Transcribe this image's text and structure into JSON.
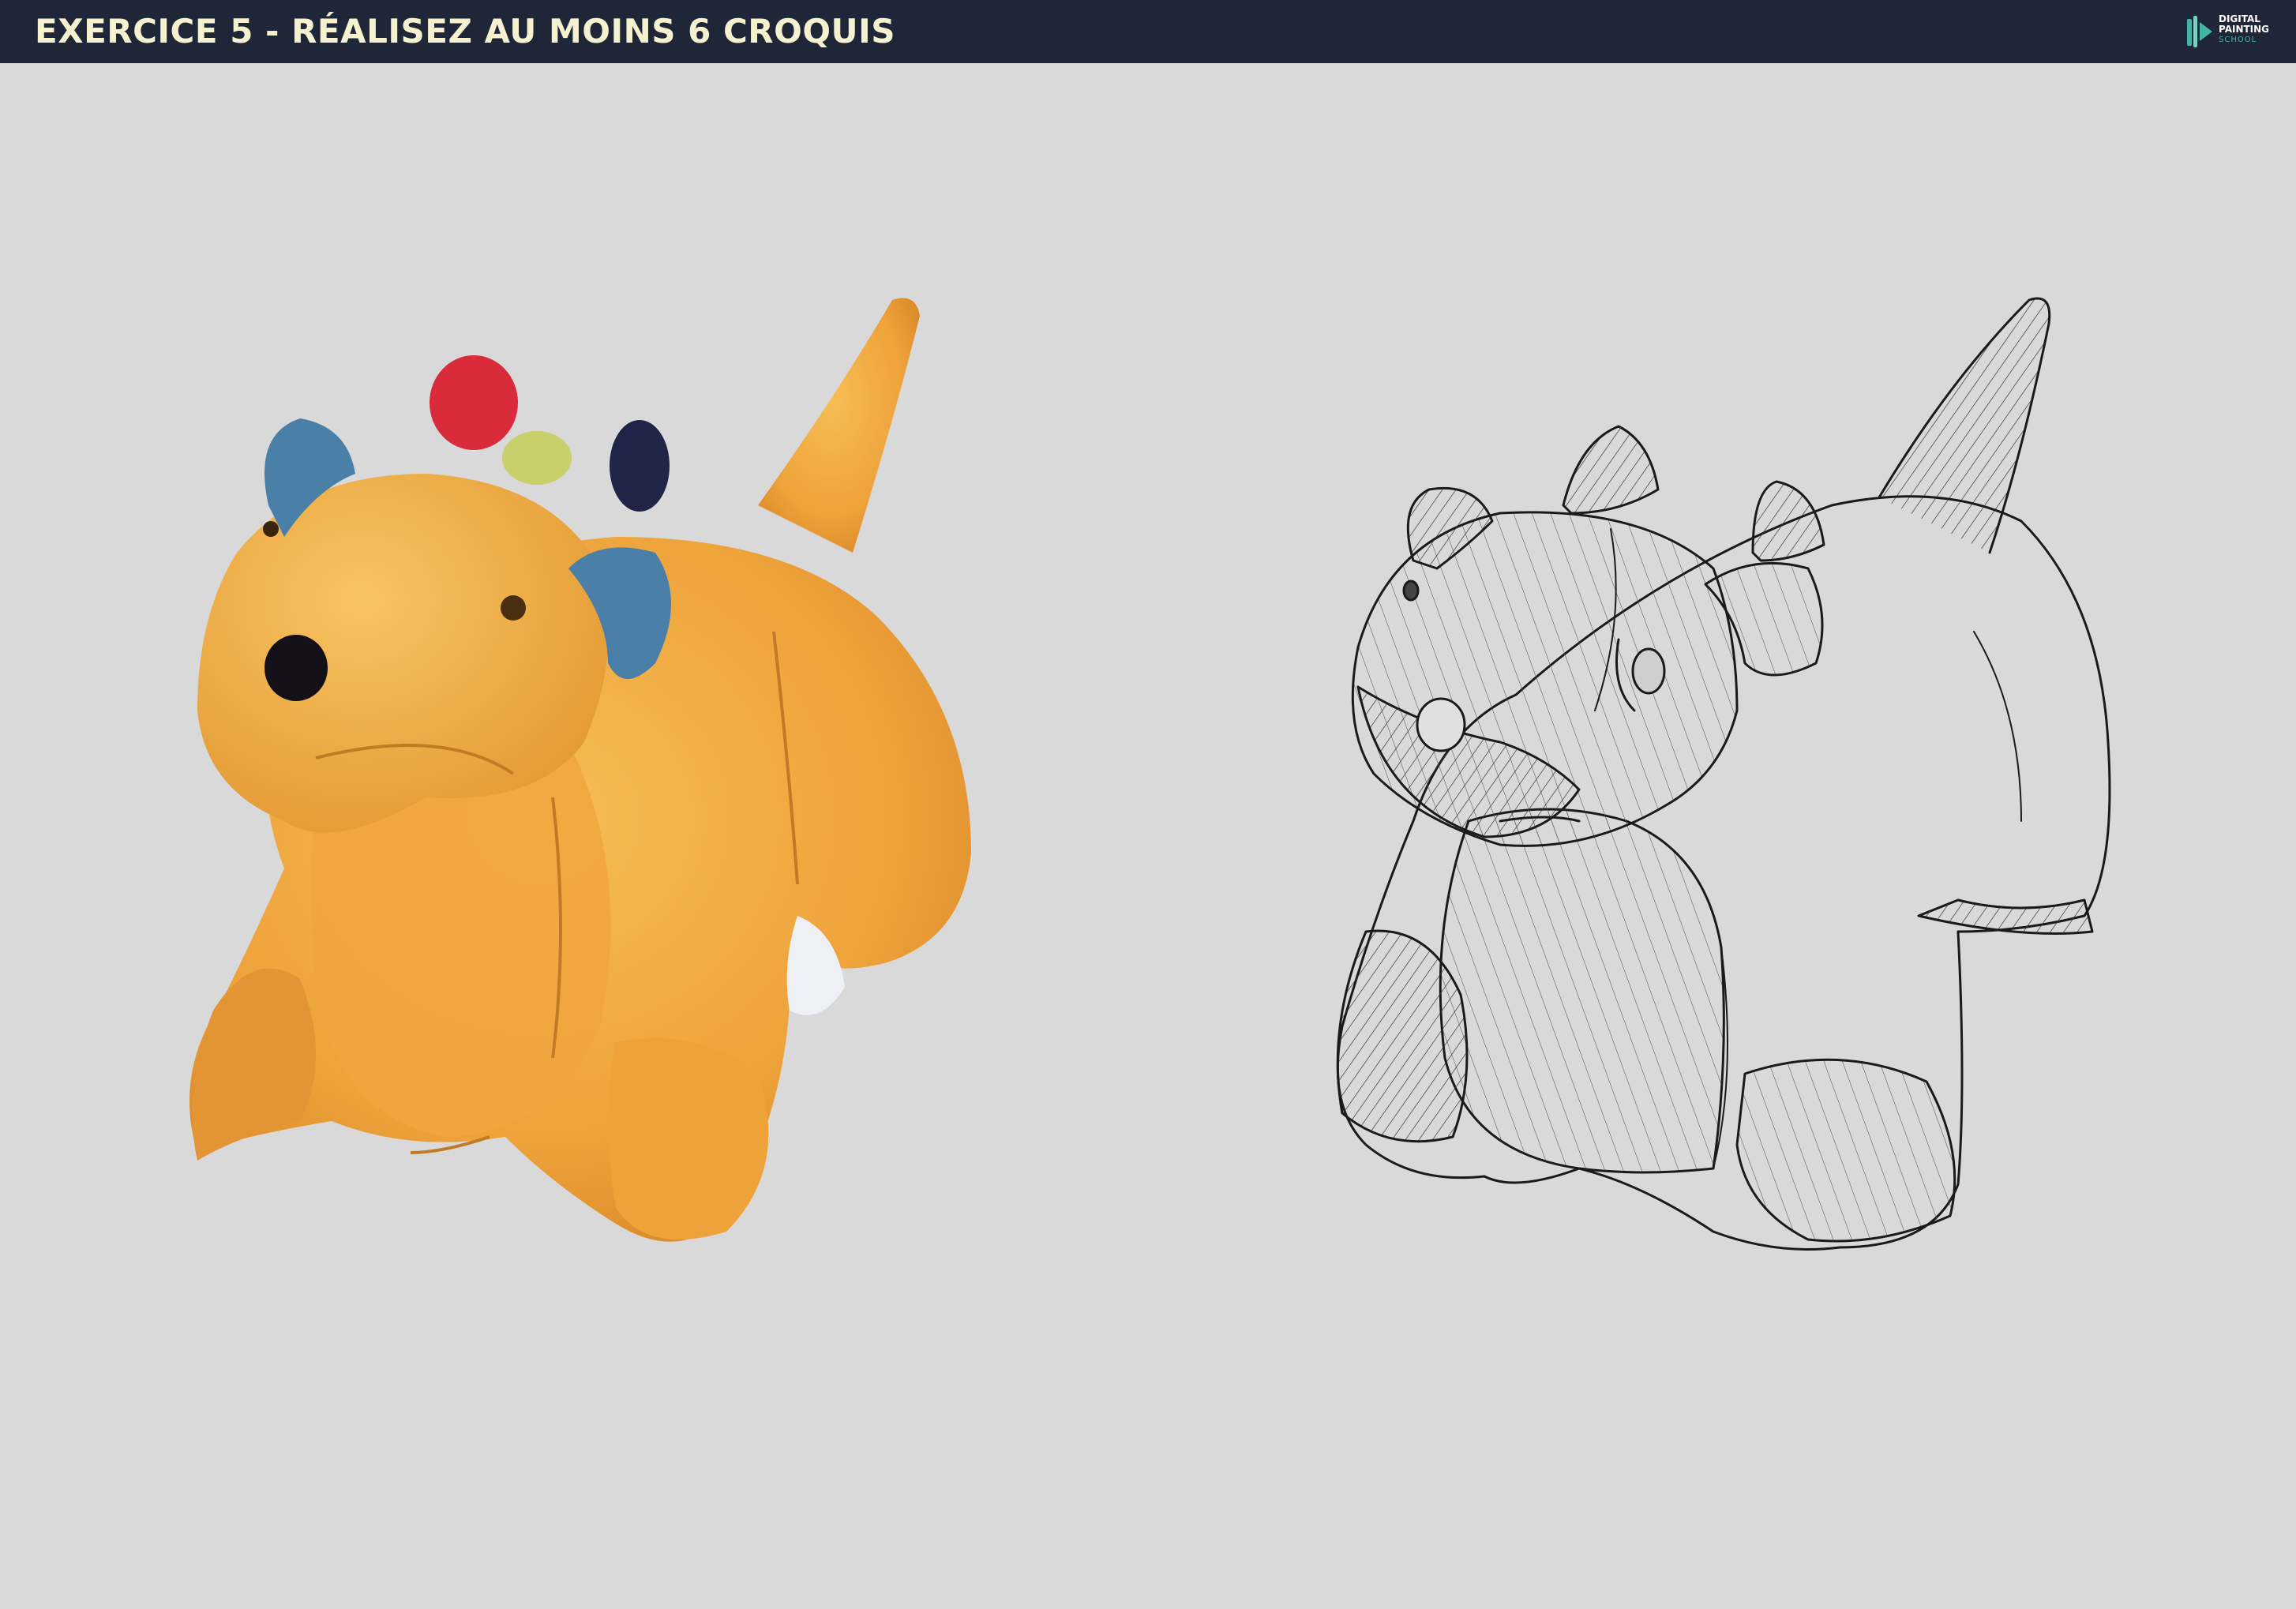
{
  "header": {
    "title": "EXERCICE 5 - RÉALISEZ AU MOINS 6 CROQUIS",
    "logo": {
      "line1": "DIGITAL",
      "line2": "PAINTING",
      "line3": "SCHOOL"
    }
  },
  "colors": {
    "header_bg": "#1f2637",
    "title_text": "#f6f1cf",
    "page_bg": "#d9d9d9",
    "plush_body": "#f2a93b",
    "logo_accent": "#3fb6a8"
  }
}
